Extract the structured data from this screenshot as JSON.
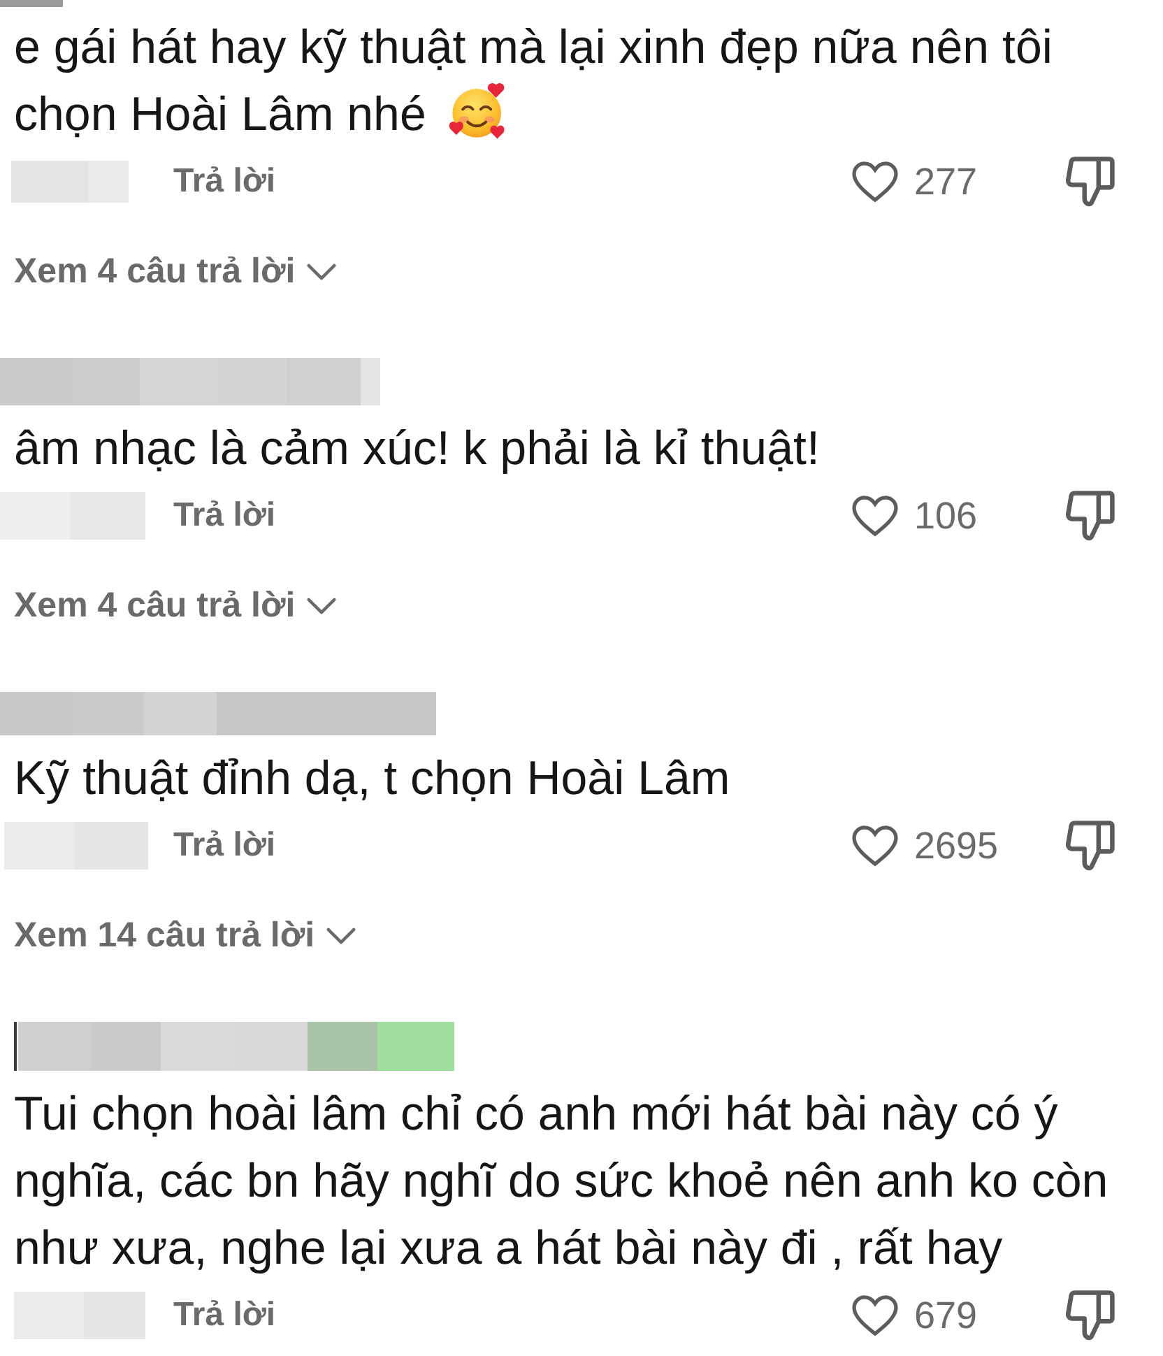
{
  "comments": [
    {
      "username_blurred": true,
      "text": "e gái hát hay kỹ thuật mà lại xinh đẹp nữa nên tôi chọn Hoài Lâm nhé",
      "emoji": true,
      "date_blurred": true,
      "reply": "Trả lời",
      "likes": "277",
      "liked": false,
      "disliked": false,
      "view_replies": "Xem 4 câu trả lời"
    },
    {
      "username_blurred": true,
      "text": "âm nhạc là cảm xúc! k phải là kỉ thuật!",
      "date_blurred": true,
      "reply": "Trả lời",
      "likes": "106",
      "liked": false,
      "disliked": false,
      "view_replies": "Xem 4 câu trả lời"
    },
    {
      "username_blurred": true,
      "text": "Kỹ thuật đỉnh dạ, t chọn Hoài Lâm",
      "date_blurred": true,
      "reply": "Trả lời",
      "likes": "2695",
      "liked": false,
      "disliked": false,
      "view_replies": "Xem 14 câu trả lời"
    },
    {
      "username_blurred": true,
      "text": "Tui chọn hoài lâm chỉ có anh mới hát bài này có ý nghĩa, các bn hãy nghĩ do sức khoẻ nên anh ko còn như xưa, nghe lại xưa a hát bài này đi , rất hay",
      "date_blurred": true,
      "reply": "Trả lời",
      "likes": "679",
      "liked": false,
      "disliked": false
    }
  ]
}
